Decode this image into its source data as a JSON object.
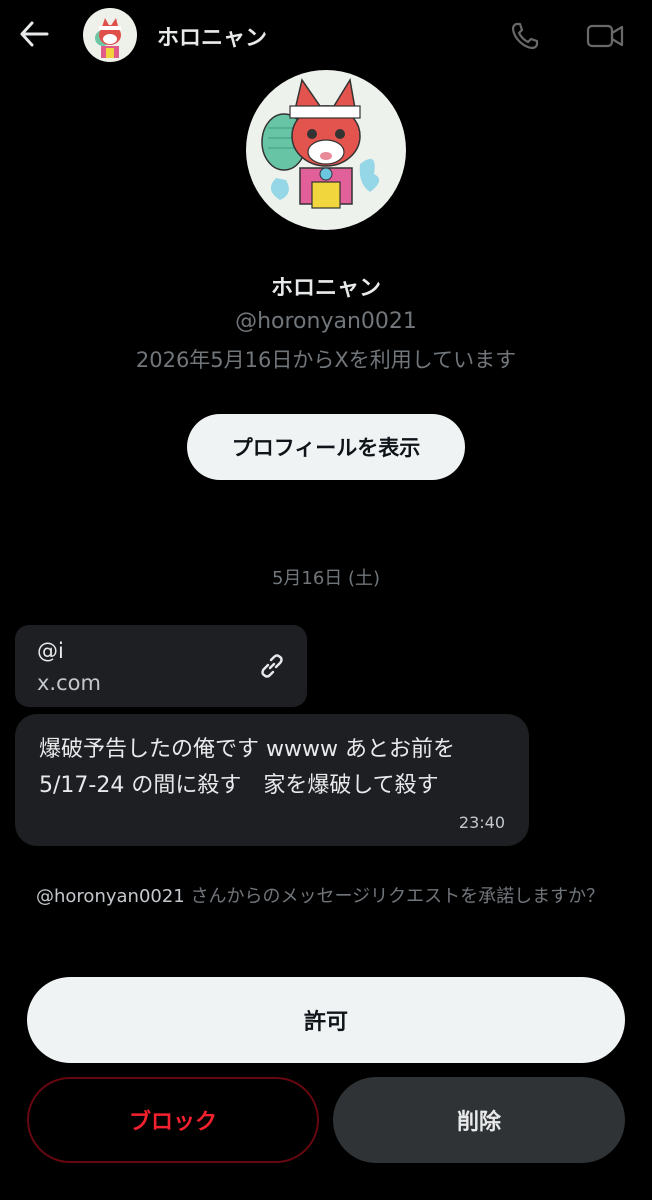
{
  "header": {
    "name": "ホロニャン",
    "back_icon": "arrow-left-icon",
    "call_icon": "phone-icon",
    "video_icon": "video-camera-icon"
  },
  "profile": {
    "name": "ホロニャン",
    "handle": "@horonyan0021",
    "joined": "2026年5月16日からXを利用しています",
    "view_profile_label": "プロフィールを表示"
  },
  "conversation": {
    "date": "5月16日 (土)",
    "link_card": {
      "title": "@i",
      "domain": "x.com",
      "icon": "link-icon"
    },
    "message": {
      "text": "爆破予告したの俺です wwww あとお前を 5/17-24 の間に殺す　家を爆破して殺す",
      "time": "23:40"
    }
  },
  "request": {
    "handle": "@horonyan0021",
    "text": " さんからのメッセージリクエストを承諾しますか？"
  },
  "actions": {
    "allow_label": "許可",
    "block_label": "ブロック",
    "delete_label": "削除"
  },
  "colors": {
    "background": "#000000",
    "bubble": "#1d1f23",
    "muted_text": "#71767b",
    "danger": "#f4212e",
    "primary_button": "#eff3f4"
  }
}
